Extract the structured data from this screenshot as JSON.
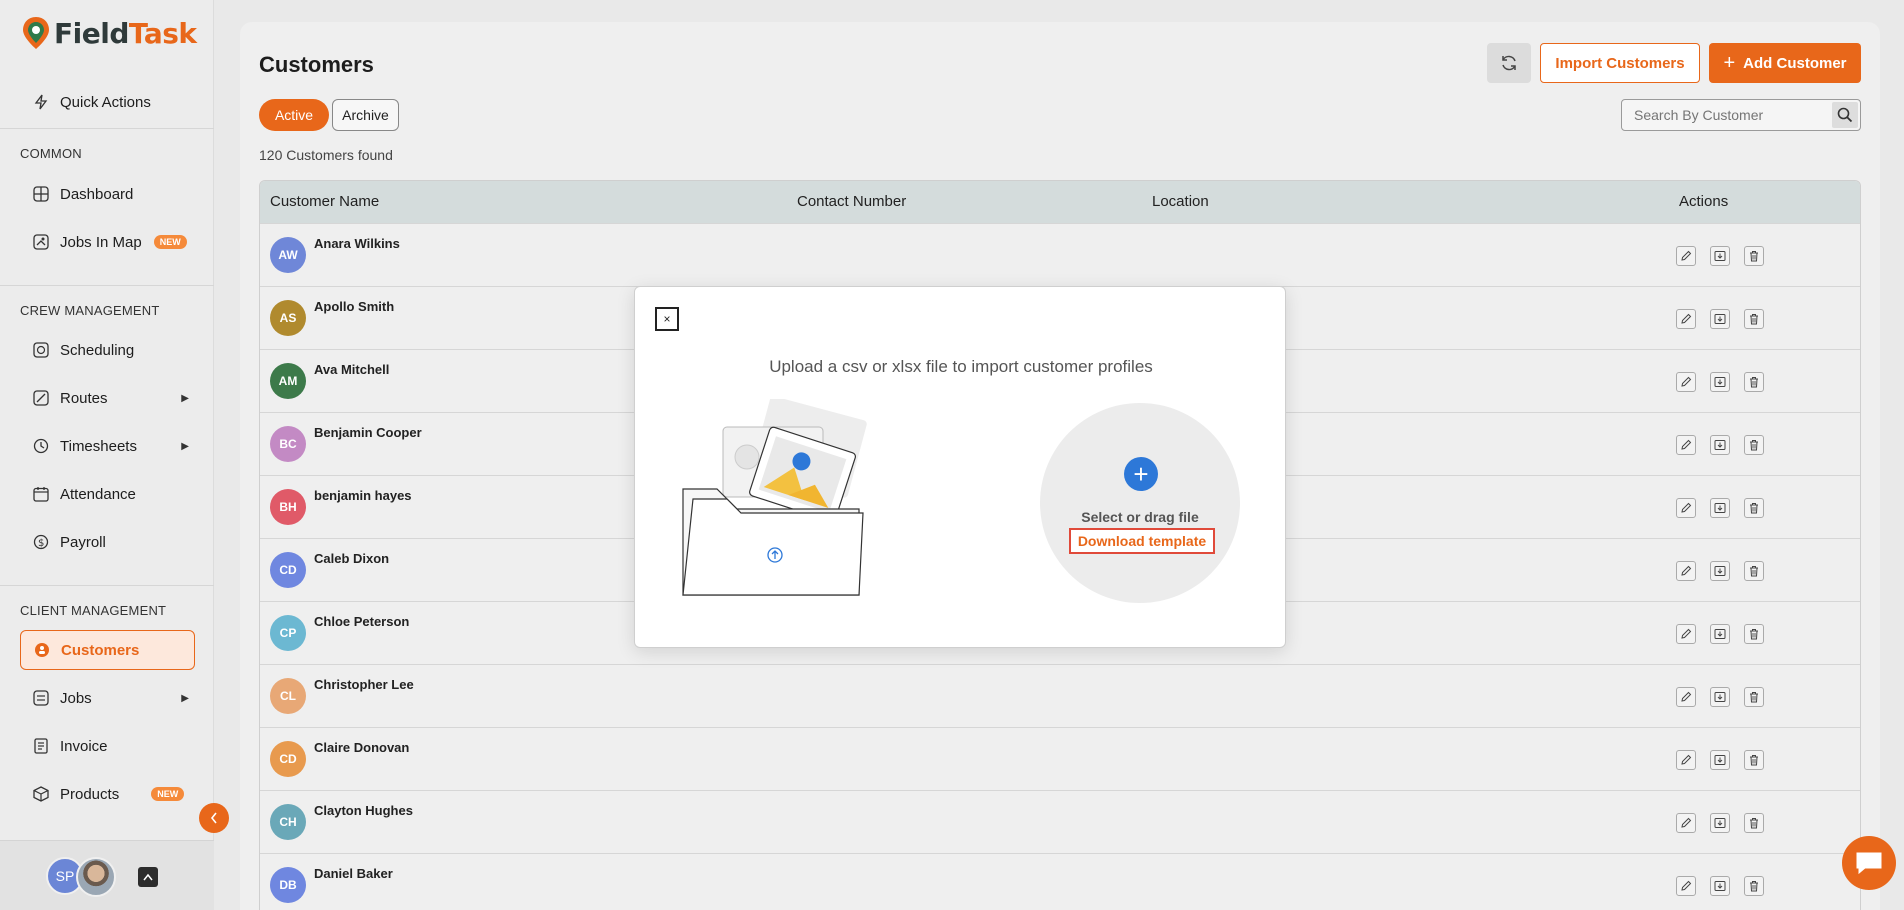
{
  "brand": {
    "name_part1": "Field",
    "name_part2": "Task"
  },
  "sidebar": {
    "quick_actions": "Quick Actions",
    "sections": {
      "common": "COMMON",
      "crew": "CREW MANAGEMENT",
      "client": "CLIENT MANAGEMENT"
    },
    "items": {
      "dashboard": "Dashboard",
      "jobs_in_map": "Jobs In Map",
      "scheduling": "Scheduling",
      "routes": "Routes",
      "timesheets": "Timesheets",
      "attendance": "Attendance",
      "payroll": "Payroll",
      "customers": "Customers",
      "jobs": "Jobs",
      "invoice": "Invoice",
      "products": "Products"
    },
    "new_badge": "NEW",
    "user_initials": "SP"
  },
  "header": {
    "title": "Customers",
    "import_label": "Import Customers",
    "add_label": "Add Customer"
  },
  "filters": {
    "active": "Active",
    "archive": "Archive",
    "search_placeholder": "Search By Customer",
    "count_text": "120 Customers found"
  },
  "table": {
    "columns": [
      "Customer Name",
      "Contact Number",
      "Location",
      "Actions"
    ],
    "rows": [
      {
        "initials": "AW",
        "name": "Anara Wilkins",
        "color": "#6f87d8"
      },
      {
        "initials": "AS",
        "name": "Apollo Smith",
        "color": "#b08a2e"
      },
      {
        "initials": "AM",
        "name": "Ava Mitchell",
        "color": "#3d7a4a"
      },
      {
        "initials": "BC",
        "name": "Benjamin Cooper",
        "color": "#c38ac4"
      },
      {
        "initials": "BH",
        "name": "benjamin hayes",
        "color": "#e05a68"
      },
      {
        "initials": "CD",
        "name": "Caleb Dixon",
        "color": "#6f87e0"
      },
      {
        "initials": "CP",
        "name": "Chloe Peterson",
        "color": "#6cb8d2"
      },
      {
        "initials": "CL",
        "name": "Christopher Lee",
        "color": "#e8a876"
      },
      {
        "initials": "CD",
        "name": "Claire Donovan",
        "color": "#e89a4e"
      },
      {
        "initials": "CH",
        "name": "Clayton Hughes",
        "color": "#6aa8b8"
      },
      {
        "initials": "DB",
        "name": "Daniel Baker",
        "color": "#6f87e0"
      }
    ]
  },
  "modal": {
    "close": "×",
    "title": "Upload a csv or xlsx file to import customer profiles",
    "drop_text": "Select or drag file",
    "download_label": "Download template"
  },
  "colors": {
    "accent": "#e8671a",
    "header_row": "#d4dcdc",
    "upload_blue": "#2d78d8"
  }
}
